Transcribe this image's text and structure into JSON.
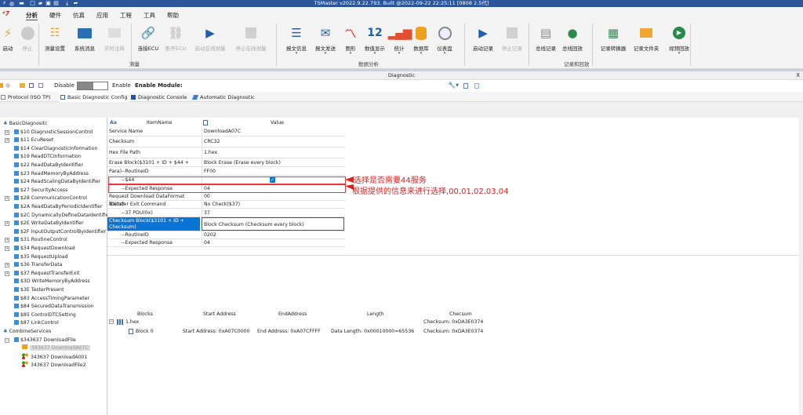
{
  "window": {
    "title": "TSMaster v2022.9.22.793. Built @2022-09-22 22:25:11 [0808 2.5代]"
  },
  "menu": [
    "分析",
    "硬件",
    "仿真",
    "应用",
    "工程",
    "工具",
    "帮助"
  ],
  "ribbon": {
    "buttons": [
      {
        "label": "启动",
        "icon": "lightning-icon",
        "enabled": true
      },
      {
        "label": "停止",
        "icon": "stop-circle-icon",
        "enabled": false
      },
      {
        "label": "测量设置",
        "icon": "tree-settings-icon",
        "enabled": true
      },
      {
        "label": "系统消息",
        "icon": "message-icon",
        "enabled": true
      },
      {
        "label": "实时注释",
        "icon": "comment-icon",
        "enabled": false
      },
      {
        "label": "连接ECU",
        "icon": "link-icon",
        "enabled": true
      },
      {
        "label": "断开ECU",
        "icon": "unlink-icon",
        "enabled": false
      },
      {
        "label": "启动在线测量",
        "icon": "play-icon",
        "enabled": false
      },
      {
        "label": "停止在线测量",
        "icon": "stop-icon",
        "enabled": false
      },
      {
        "label": "报文信息",
        "icon": "list-icon",
        "enabled": true,
        "dropdown": true
      },
      {
        "label": "报文发送",
        "icon": "mail-send-icon",
        "enabled": true,
        "dropdown": true
      },
      {
        "label": "图形",
        "icon": "line-chart-icon",
        "enabled": true,
        "dropdown": true
      },
      {
        "label": "数值显示",
        "icon": "number-icon",
        "enabled": true,
        "dropdown": true,
        "glyph": "12"
      },
      {
        "label": "统计",
        "icon": "bar-chart-icon",
        "enabled": true,
        "dropdown": true
      },
      {
        "label": "数据库",
        "icon": "database-icon",
        "enabled": true,
        "dropdown": true
      },
      {
        "label": "仪表盘",
        "icon": "gauge-icon",
        "enabled": true,
        "dropdown": true
      },
      {
        "label": "启动记录",
        "icon": "play-icon",
        "enabled": true
      },
      {
        "label": "停止记录",
        "icon": "stop-icon",
        "enabled": false
      },
      {
        "label": "总线记录",
        "icon": "bus-record-icon",
        "enabled": true
      },
      {
        "label": "总线回放",
        "icon": "bus-replay-icon",
        "enabled": true
      },
      {
        "label": "记录转换器",
        "icon": "converter-icon",
        "enabled": true
      },
      {
        "label": "记录文件夹",
        "icon": "folder-icon",
        "enabled": true
      },
      {
        "label": "视频回放",
        "icon": "video-play-icon",
        "enabled": true,
        "dropdown": true
      }
    ],
    "groups": [
      "测量",
      "数据分析",
      "记录和回放"
    ]
  },
  "diagnostic": {
    "title": "Diagnostic",
    "close": "X",
    "toolbar": {
      "disable": "Disable",
      "enable": "Enable",
      "module": "Enable Module:"
    },
    "tabs": [
      "Protocol (ISO TP)",
      "Basic Diagnostic Config",
      "Diagnostic Console",
      "Automatic Diagnostic"
    ]
  },
  "tree": [
    {
      "label": "BasicDiagnositc",
      "level": 0,
      "type": "root"
    },
    {
      "label": "$10 DiagnosticSessionControl",
      "level": 1,
      "expand": true
    },
    {
      "label": "$11 EcuReset",
      "level": 1,
      "expand": true
    },
    {
      "label": "$14 ClearDiagnosticInformation",
      "level": 1
    },
    {
      "label": "$19 ReadDTCInformation",
      "level": 1
    },
    {
      "label": "$22 ReadDataByIdentifier",
      "level": 1
    },
    {
      "label": "$23 ReadMemoryByAddress",
      "level": 1
    },
    {
      "label": "$24 ReadScalingDataByIdentifier",
      "level": 1
    },
    {
      "label": "$27 SecurityAccess",
      "level": 1
    },
    {
      "label": "$28 CommunicationControl",
      "level": 1,
      "expand": true
    },
    {
      "label": "$2A ReadDataByPeriodicIdentifier",
      "level": 1
    },
    {
      "label": "$2C DynamicallyDefineDataIdentifier",
      "level": 1
    },
    {
      "label": "$2E WriteDataByIdentifier",
      "level": 1,
      "expand": true
    },
    {
      "label": "$2F InputOutputControlByIdentifier",
      "level": 1
    },
    {
      "label": "$31 RoutineControl",
      "level": 1,
      "expand": true
    },
    {
      "label": "$34 RequestDownload",
      "level": 1,
      "expand": true
    },
    {
      "label": "$35 RequestUpload",
      "level": 1
    },
    {
      "label": "$36 TransferData",
      "level": 1,
      "expand": true
    },
    {
      "label": "$37 RequestTransferExit",
      "level": 1,
      "expand": true
    },
    {
      "label": "$3D WriteMemoryByAddress",
      "level": 1
    },
    {
      "label": "$3E TesterPresent",
      "level": 1
    },
    {
      "label": "$83 AccessTimingParameter",
      "level": 1
    },
    {
      "label": "$84 SecuredDataTransmission",
      "level": 1
    },
    {
      "label": "$85 ControlDTCSetting",
      "level": 1
    },
    {
      "label": "$87 LinkControl",
      "level": 1
    },
    {
      "label": "CombineServices",
      "level": 0,
      "type": "root"
    },
    {
      "label": "$343637 DownloadFile",
      "level": 1,
      "expand": true
    },
    {
      "label": "343637 DownloadA07C",
      "level": 2,
      "selected": true
    },
    {
      "label": "343637 DownloadA001",
      "level": 2,
      "type": "dots"
    },
    {
      "label": "343637 DownloadFile2",
      "level": 2,
      "type": "dots"
    }
  ],
  "grid": {
    "headers": {
      "name": "ItemName",
      "value": "Value",
      "aa": "Aa"
    },
    "rows": [
      {
        "name": "Service Name",
        "value": "DownloadA07C"
      },
      {
        "name": "Checksum",
        "value": "CRC32"
      },
      {
        "name": "Hex File Path",
        "value": "1.hex"
      },
      {
        "name": "Erase Block($3101 + ID + $44 + Para)",
        "value": "Block Erase (Erase every block)"
      },
      {
        "name": "--RoutineID",
        "value": "FF00",
        "indent": true
      },
      {
        "name": "--$44",
        "value": "",
        "indent": true,
        "checkbox": true,
        "checked": true
      },
      {
        "name": "--Expected Response",
        "value": "04",
        "indent": true
      },
      {
        "name": "Request Download DataFormat ID(0x)",
        "value": "00"
      },
      {
        "name": "Transfer Exit Command",
        "value": "No Check($37)"
      },
      {
        "name": "--37 PDU(0x)",
        "value": "37",
        "indent": true
      },
      {
        "name": "Checksum Block($3101 + ID + Checksum)",
        "value": "Block Checksum (Checksum every block)",
        "selected": true
      },
      {
        "name": "--RoutineID",
        "value": "0202",
        "indent": true
      },
      {
        "name": "--Expected Response",
        "value": "04",
        "indent": true
      }
    ]
  },
  "annotations": [
    "选择是否需要44服务",
    "根据提供的信息来进行选择,00,01,02,03,04"
  ],
  "blocks": {
    "headers": [
      "Blocks",
      "Start Address",
      "EndAddress",
      "Length",
      "Checsum"
    ],
    "file": {
      "name": "1.hex",
      "checksum": "Checksum: 0xDA3E0374"
    },
    "rows": [
      {
        "name": "Block 0",
        "start": "Start Address: 0xA07C0000",
        "end": "End Address: 0xA07CFFFF",
        "length": "Data Length: 0x00010000=65536",
        "checksum": "Checksum: 0xDA3E0374"
      }
    ]
  },
  "colors": {
    "titlebar": "#2b579a",
    "accent": "#0a74d6",
    "annotation": "#e02020"
  }
}
